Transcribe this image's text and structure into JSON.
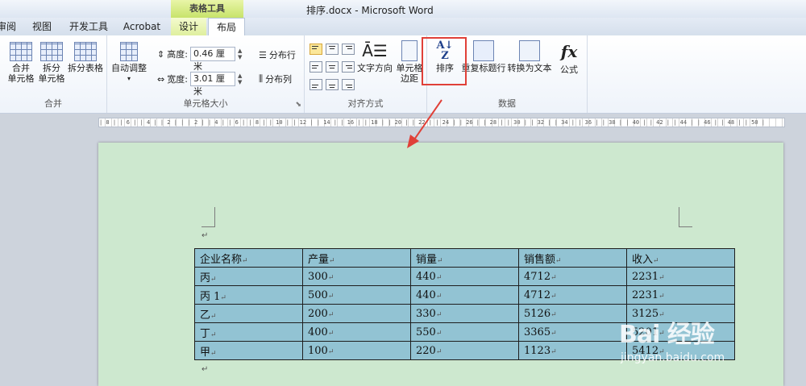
{
  "window": {
    "title": "排序.docx - Microsoft Word",
    "context_group": "表格工具"
  },
  "tabs": [
    "审阅",
    "视图",
    "开发工具",
    "Acrobat",
    "设计",
    "布局"
  ],
  "ribbon": {
    "merge": {
      "label": "合并",
      "merge_cells": "合并\n单元格",
      "split_cells": "拆分\n单元格",
      "split_table": "拆分表格"
    },
    "cell_size": {
      "label": "单元格大小",
      "autofit": "自动调整",
      "height_label": "高度:",
      "height_value": "0.46 厘米",
      "width_label": "宽度:",
      "width_value": "3.01 厘米",
      "distribute_rows": "分布行",
      "distribute_cols": "分布列"
    },
    "alignment": {
      "label": "对齐方式",
      "text_direction": "文字方向",
      "cell_margins": "单元格\n边距"
    },
    "data": {
      "label": "数据",
      "sort": "排序",
      "repeat_header": "重复标题行",
      "convert_to_text": "转换为文本",
      "formula": "公式"
    }
  },
  "ruler_text": "| 8 | | 6 | | 4 | | 2 | | | 2 | | 4 | | 6 | | 8 | | 10 | | 12 | | 14 | | 16 | | 18 | | 20 | | 22 | | 24 | | 26 | | 28 | | 30 | | 32 | | 34 | | 36 | | 38 | | 40 | | 42 | | 44 | | 46 | | 48 | | 50 |",
  "table": {
    "header": [
      "企业名称",
      "产量",
      "销量",
      "销售额",
      "收入"
    ],
    "rows": [
      [
        "丙",
        "300",
        "440",
        "4712",
        "2231"
      ],
      [
        "丙 1",
        "500",
        "440",
        "4712",
        "2231"
      ],
      [
        "乙",
        "200",
        "330",
        "5126",
        "3125"
      ],
      [
        "丁",
        "400",
        "550",
        "3365",
        "5201"
      ],
      [
        "甲",
        "100",
        "220",
        "1123",
        "5412"
      ]
    ]
  },
  "watermark": {
    "logo": "Bai  经验",
    "url": "jingyan.baidu.com"
  },
  "colors": {
    "accent_highlight": "#e04038",
    "page_bg": "#cde8cf",
    "table_fill": "#92c3d3"
  }
}
